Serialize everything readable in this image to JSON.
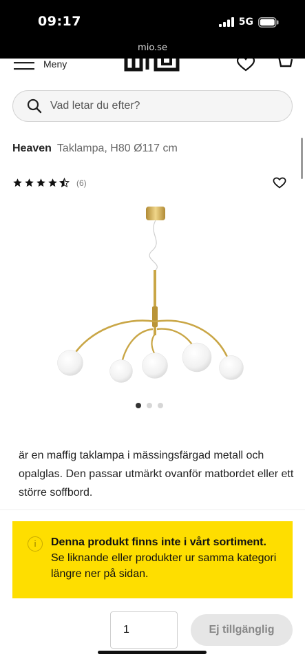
{
  "status_bar": {
    "time": "09:17",
    "network": "5G",
    "url": "mio.se"
  },
  "header": {
    "menu_label": "Meny"
  },
  "search": {
    "placeholder": "Vad letar du efter?"
  },
  "product": {
    "brand": "Heaven",
    "subtitle": "Taklampa, H80 Ø117 cm",
    "rating": 4.5,
    "rating_max": 5,
    "review_count": "(6)",
    "carousel": {
      "total": 3,
      "active": 1
    },
    "description": "är en maffig taklampa i mässingsfärgad metall och opalglas. Den passar utmärkt ovanför matbordet eller ett större soffbord."
  },
  "notice": {
    "icon": "info-icon",
    "title": "Denna produkt finns inte i vårt sortiment.",
    "body": "Se liknande eller produkter ur samma kategori längre ner på sidan."
  },
  "purchase": {
    "quantity": "1",
    "button_label": "Ej tillgänglig"
  },
  "colors": {
    "accent_yellow": "#fede00",
    "brass": "#c9a646",
    "disabled_button": "#e6e6e6"
  }
}
